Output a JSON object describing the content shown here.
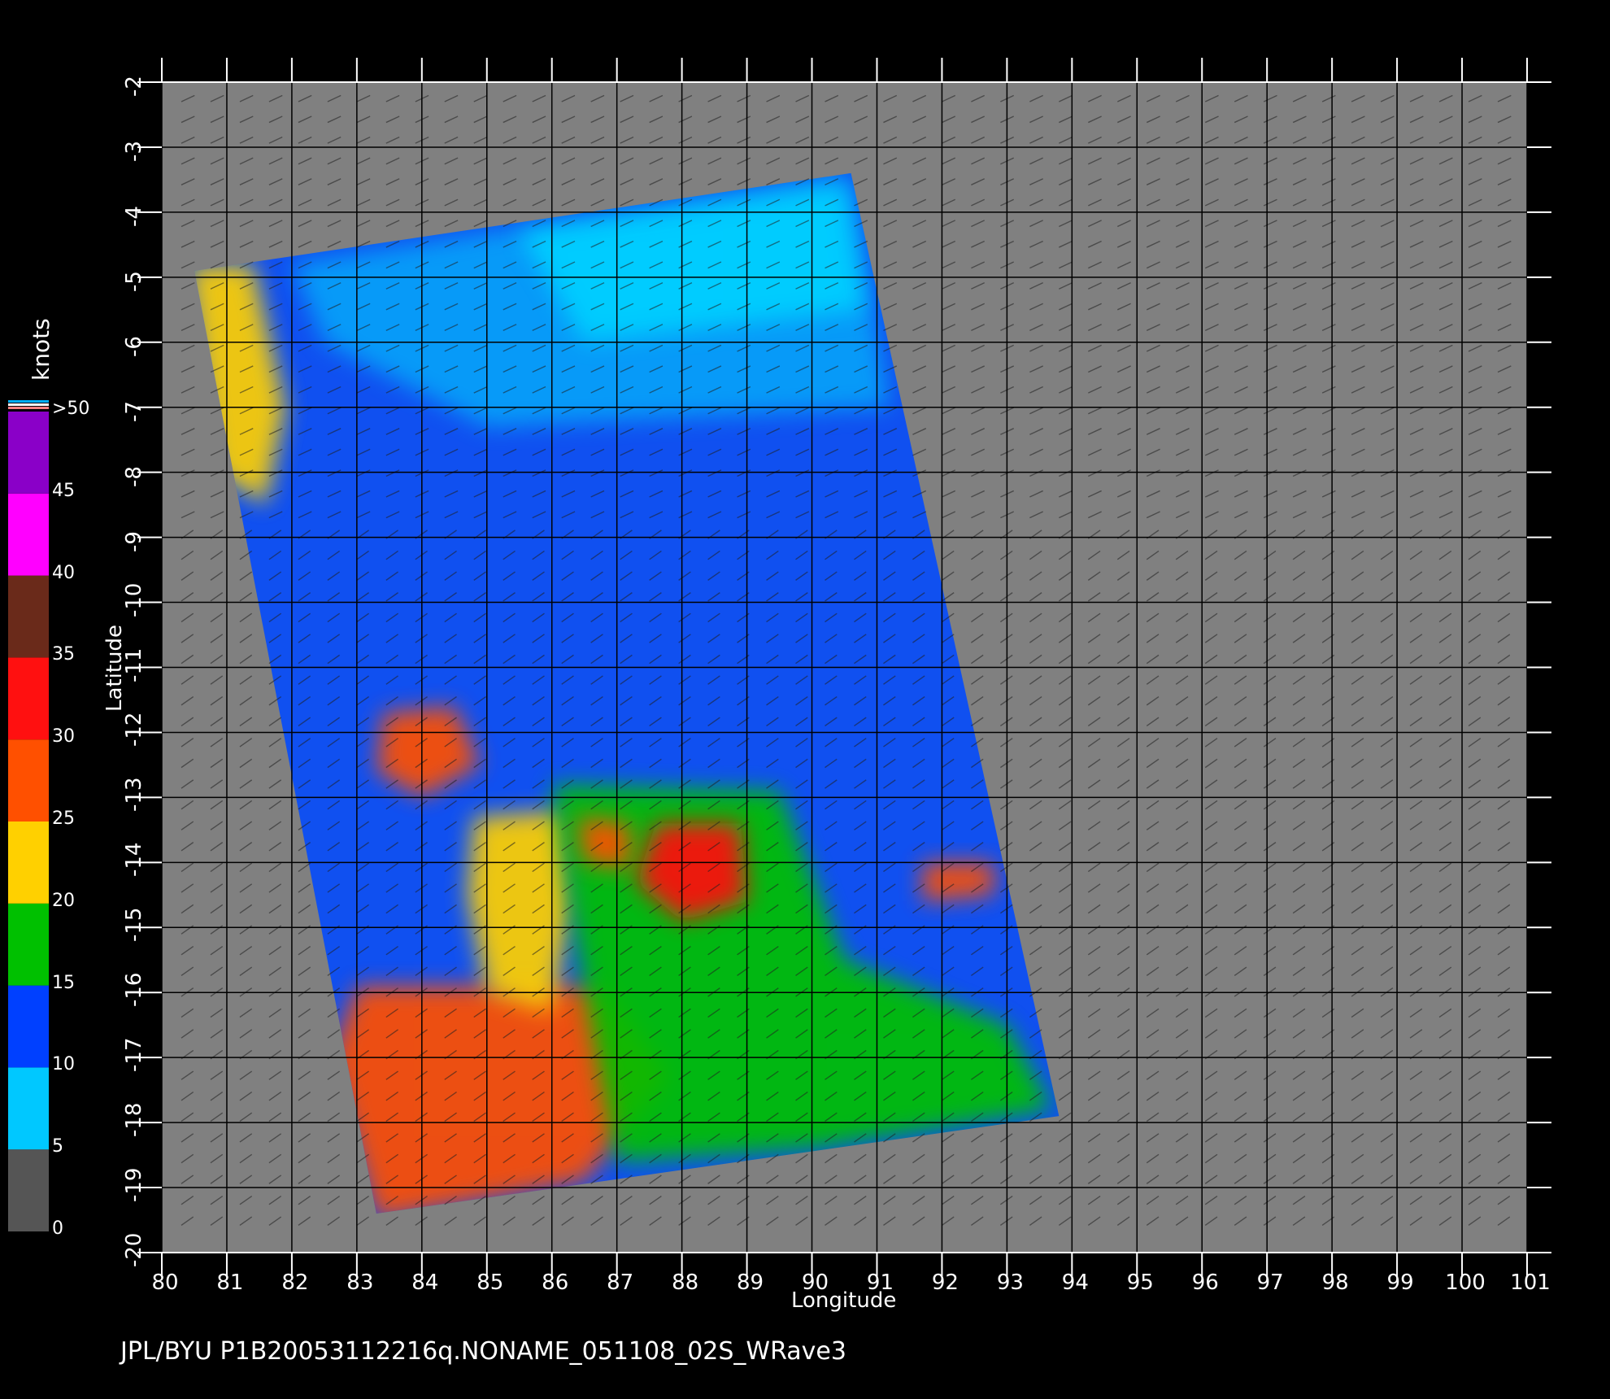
{
  "footer": "JPL/BYU  P1B20053112216q.NONAME_051108_02S_WRave3",
  "map": {
    "xlabel": "Longitude",
    "ylabel": "Latitude",
    "lon_range": [
      80,
      101
    ],
    "lat_range": [
      -20,
      -2
    ],
    "lon_ticks": [
      "80",
      "81",
      "82",
      "83",
      "84",
      "85",
      "86",
      "87",
      "88",
      "89",
      "90",
      "91",
      "92",
      "93",
      "94",
      "95",
      "96",
      "97",
      "98",
      "99",
      "100",
      "101"
    ],
    "lat_ticks": [
      "-2",
      "-3",
      "-4",
      "-5",
      "-6",
      "-7",
      "-8",
      "-9",
      "-10",
      "-11",
      "-12",
      "-13",
      "-14",
      "-15",
      "-16",
      "-17",
      "-18",
      "-19",
      "-20"
    ],
    "swath_corners_lonlat": [
      [
        80.5,
        -4.9
      ],
      [
        90.6,
        -3.4
      ],
      [
        93.8,
        -17.9
      ],
      [
        83.3,
        -19.4
      ]
    ],
    "background_color": "#808080"
  },
  "colorbar": {
    "units": "knots",
    "labels": [
      "0",
      "5",
      "10",
      "15",
      "20",
      "25",
      "30",
      "35",
      "40",
      "45",
      ">50"
    ],
    "bins": [
      {
        "from": 0,
        "to": 5,
        "color": "#555555"
      },
      {
        "from": 5,
        "to": 10,
        "color": "#00c8ff"
      },
      {
        "from": 10,
        "to": 15,
        "color": "#0040ff"
      },
      {
        "from": 15,
        "to": 20,
        "color": "#00c000"
      },
      {
        "from": 20,
        "to": 25,
        "color": "#ffd000"
      },
      {
        "from": 25,
        "to": 30,
        "color": "#ff5000"
      },
      {
        "from": 30,
        "to": 35,
        "color": "#ff1010"
      },
      {
        "from": 35,
        "to": 40,
        "color": "#6a2a1a"
      },
      {
        "from": 40,
        "to": 45,
        "color": "#ff00ff"
      },
      {
        "from": 45,
        "to": 50,
        "color": "#8a00c8"
      }
    ]
  },
  "wind_regions": [
    {
      "name": "southwest-high-winds",
      "lon": 84.5,
      "lat": -17.5,
      "speed_kt": 28
    },
    {
      "name": "central-jet",
      "lon": 85.8,
      "lat": -14.5,
      "speed_kt": 24
    },
    {
      "name": "green-band",
      "lon": 88.0,
      "lat": -16.5,
      "speed_kt": 17
    },
    {
      "name": "northwest-strip",
      "lon": 81.2,
      "lat": -6.0,
      "speed_kt": 24
    },
    {
      "name": "cell-84-12",
      "lon": 83.9,
      "lat": -12.3,
      "speed_kt": 28
    },
    {
      "name": "cell-88-14",
      "lon": 88.4,
      "lat": -14.0,
      "speed_kt": 30
    },
    {
      "name": "cell-86-14",
      "lon": 86.8,
      "lat": -13.7,
      "speed_kt": 26
    },
    {
      "name": "cell-92-14",
      "lon": 92.2,
      "lat": -14.3,
      "speed_kt": 26
    },
    {
      "name": "north-calm-area",
      "lon": 87.5,
      "lat": -5.0,
      "speed_kt": 7
    }
  ]
}
